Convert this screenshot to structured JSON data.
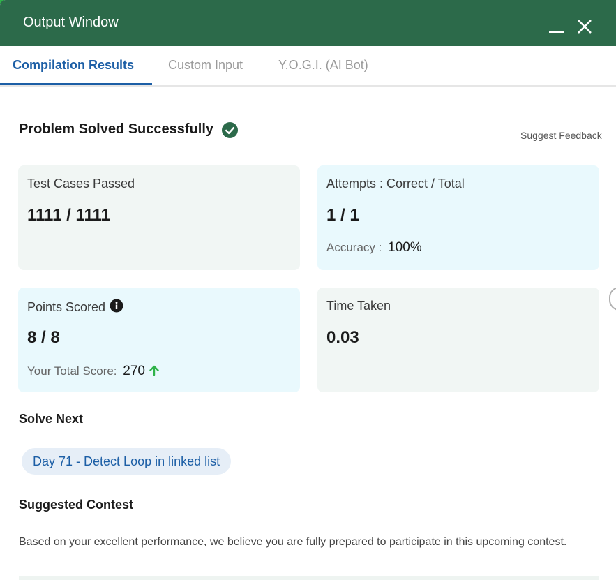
{
  "window": {
    "title": "Output Window",
    "minimize_icon": "minimize-icon",
    "close_icon": "close-icon",
    "header_color": "#2c6a4a"
  },
  "tabs": [
    {
      "label": "Compilation Results",
      "active": true
    },
    {
      "label": "Custom Input",
      "active": false
    },
    {
      "label": "Y.O.G.I. (AI Bot)",
      "active": false
    }
  ],
  "result": {
    "heading": "Problem Solved Successfully",
    "status_icon": "check-circle-icon",
    "feedback_link": "Suggest Feedback"
  },
  "cards": {
    "test_cases": {
      "label": "Test Cases Passed",
      "value": "1111 / 1111"
    },
    "attempts": {
      "label": "Attempts : Correct / Total",
      "value": "1 / 1",
      "sub_label": "Accuracy :",
      "sub_value": "100%"
    },
    "points": {
      "label": "Points Scored",
      "value": "8 / 8",
      "sub_label": "Your Total Score:",
      "sub_value": "270",
      "info_icon": "info-icon",
      "trend_icon": "arrow-up-icon"
    },
    "time": {
      "label": "Time Taken",
      "value": "0.03"
    }
  },
  "solve_next": {
    "title": "Solve Next",
    "problem": "Day 71 - Detect Loop in linked list"
  },
  "contest": {
    "title": "Suggested Contest",
    "description": "Based on your excellent performance, we believe you are fully prepared to participate in this upcoming contest."
  },
  "colors": {
    "accent": "#1d5fa6",
    "success": "#2c6a4a",
    "card_gray": "#f1f6f4",
    "card_blue": "#e9f9fd",
    "trend_up": "#2fb34a"
  }
}
